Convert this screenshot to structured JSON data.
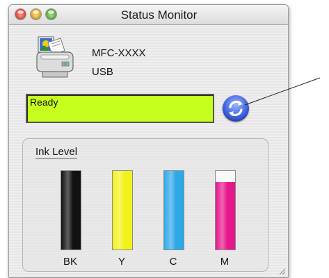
{
  "window": {
    "title": "Status Monitor"
  },
  "device": {
    "model": "MFC-XXXX",
    "connection": "USB",
    "icon": "printer-fax-icon"
  },
  "status": {
    "text": "Ready",
    "color": "#c6ff1e"
  },
  "refresh": {
    "icon": "refresh-icon"
  },
  "ink": {
    "title": "Ink Level",
    "cartridges": [
      {
        "label": "BK",
        "level": 1.0,
        "color": "#111111"
      },
      {
        "label": "Y",
        "level": 1.0,
        "color": "#f2f21a"
      },
      {
        "label": "C",
        "level": 1.0,
        "color": "#2fa8e8"
      },
      {
        "label": "M",
        "level": 0.86,
        "color": "#e6178b"
      }
    ]
  }
}
